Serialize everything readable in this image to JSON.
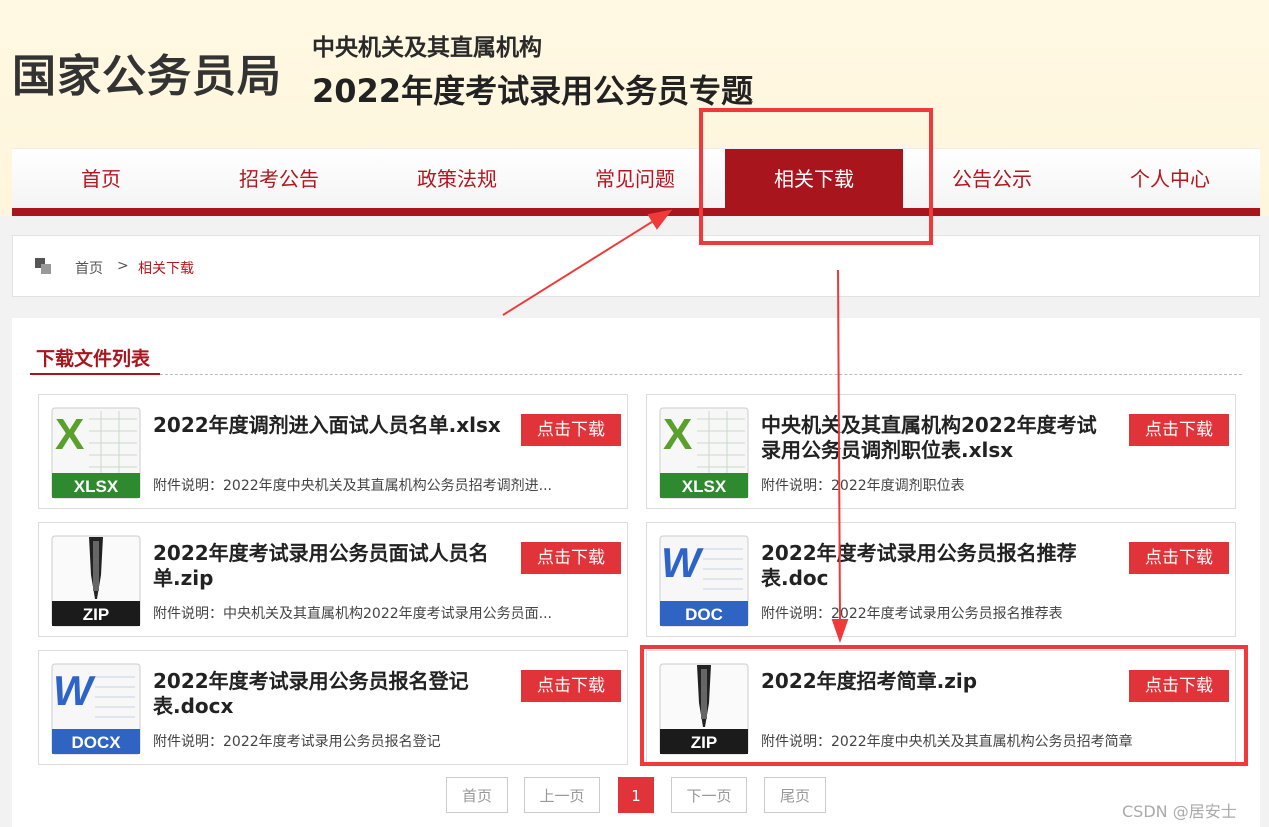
{
  "header": {
    "logo": "国家公务员局",
    "subtitle": "中央机关及其直属机构",
    "title": "2022年度考试录用公务员专题"
  },
  "nav": {
    "items": [
      "首页",
      "招考公告",
      "政策法规",
      "常见问题",
      "相关下载",
      "公告公示",
      "个人中心"
    ],
    "active_index": 4
  },
  "breadcrumb": {
    "home": "首页",
    "separator": ">",
    "current": "相关下载"
  },
  "section": {
    "title": "下载文件列表"
  },
  "files": [
    {
      "icon": "xlsx-file-icon",
      "badge": "XLSX",
      "title": "2022年度调剂进入面试人员名单.xlsx",
      "desc": "附件说明：2022年度中央机关及其直属机构公务员招考调剂进...",
      "button": "点击下载"
    },
    {
      "icon": "xlsx-file-icon",
      "badge": "XLSX",
      "title": "中央机关及其直属机构2022年度考试录用公务员调剂职位表.xlsx",
      "desc": "附件说明：2022年度调剂职位表",
      "button": "点击下载"
    },
    {
      "icon": "zip-file-icon",
      "badge": "ZIP",
      "title": "2022年度考试录用公务员面试人员名单.zip",
      "desc": "附件说明：中央机关及其直属机构2022年度考试录用公务员面...",
      "button": "点击下载"
    },
    {
      "icon": "doc-file-icon",
      "badge": "DOC",
      "title": "2022年度考试录用公务员报名推荐表.doc",
      "desc": "附件说明：2022年度考试录用公务员报名推荐表",
      "button": "点击下载"
    },
    {
      "icon": "docx-file-icon",
      "badge": "DOCX",
      "title": "2022年度考试录用公务员报名登记表.docx",
      "desc": "附件说明：2022年度考试录用公务员报名登记",
      "button": "点击下载"
    },
    {
      "icon": "zip-file-icon",
      "badge": "ZIP",
      "title": "2022年度招考简章.zip",
      "desc": "附件说明：2022年度中央机关及其直属机构公务员招考简章",
      "button": "点击下载"
    }
  ],
  "pagination": {
    "first": "首页",
    "prev": "上一页",
    "current": "1",
    "next": "下一页",
    "last": "尾页"
  },
  "colors": {
    "brand_red": "#a8151c",
    "button_red": "#e0333a",
    "annotation_red": "#f03a3a"
  },
  "watermark": "CSDN @居安士"
}
